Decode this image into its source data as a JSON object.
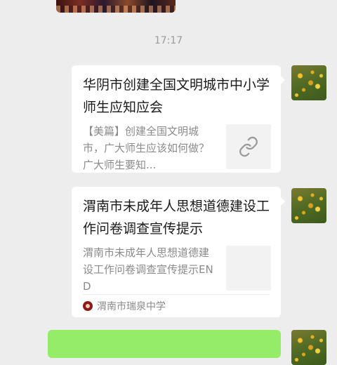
{
  "chat": {
    "timestamp": "17:17",
    "messages": [
      {
        "title": "华阴市创建全国文明城市中小学师生应知应会",
        "description": "【美篇】创建全国文明城市，广大师生应该如何做？广大师生要知...",
        "thumbnail_icon": "link-icon"
      },
      {
        "title": "渭南市未成年人思想道德建设工作问卷调查宣传提示",
        "description": "渭南市未成年人思想道德建设工作问卷调查宣传提示END",
        "source": "渭南市瑞泉中学"
      }
    ]
  },
  "colors": {
    "background": "#ededed",
    "bubble": "#ffffff",
    "outgoing_bubble": "#95ec69"
  }
}
